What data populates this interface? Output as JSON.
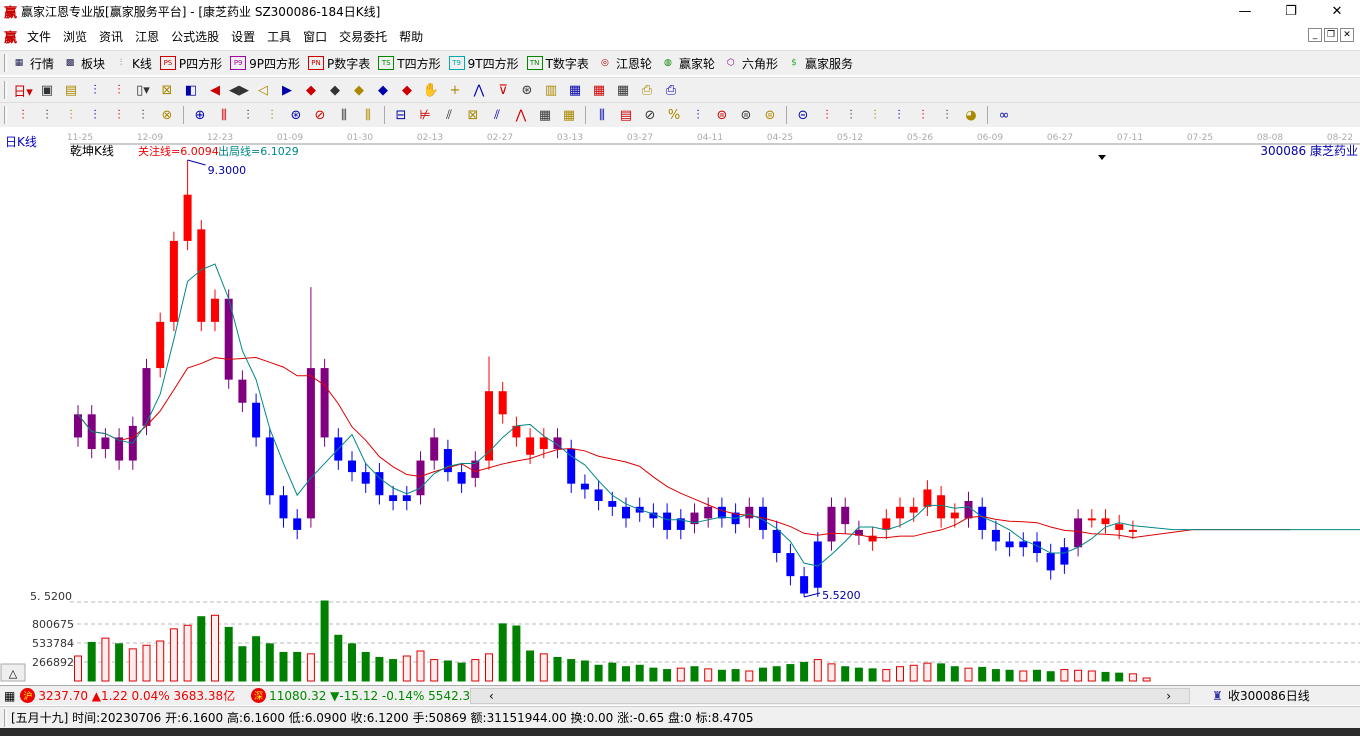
{
  "window": {
    "logo": "赢",
    "title": "赢家江恩专业版[赢家服务平台] - [康芝药业  SZ300086-184日K线]",
    "min": "—",
    "max": "❐",
    "close": "✕"
  },
  "menu": {
    "logo": "赢",
    "items": [
      "文件",
      "浏览",
      "资讯",
      "江恩",
      "公式选股",
      "设置",
      "工具",
      "窗口",
      "交易委托",
      "帮助"
    ]
  },
  "toolbar1": [
    {
      "icon": "grid-icon",
      "glyph": "▦",
      "label": "行情"
    },
    {
      "icon": "blocks-icon",
      "glyph": "▩",
      "label": "板块"
    },
    {
      "icon": "candles-icon",
      "glyph": "⫶",
      "label": "K线"
    },
    {
      "icon": "ps-icon",
      "glyph": "PS",
      "label": "P四方形",
      "color": "#c00"
    },
    {
      "icon": "p9-icon",
      "glyph": "P9",
      "label": "9P四方形",
      "color": "#a0a"
    },
    {
      "icon": "pn-icon",
      "glyph": "PN",
      "label": "P数字表",
      "color": "#c00"
    },
    {
      "icon": "ts-icon",
      "glyph": "TS",
      "label": "T四方形",
      "color": "#080"
    },
    {
      "icon": "t9-icon",
      "glyph": "T9",
      "label": "9T四方形",
      "color": "#0aa"
    },
    {
      "icon": "tn-icon",
      "glyph": "TN",
      "label": "T数字表",
      "color": "#080"
    },
    {
      "icon": "gann-wheel-icon",
      "glyph": "◎",
      "label": "江恩轮",
      "color": "#a00"
    },
    {
      "icon": "winner-wheel-icon",
      "glyph": "◍",
      "label": "赢家轮",
      "color": "#080"
    },
    {
      "icon": "hexagon-icon",
      "glyph": "⬡",
      "label": "六角形",
      "color": "#808"
    },
    {
      "icon": "dollar-icon",
      "glyph": "$",
      "label": "赢家服务",
      "color": "#3a3"
    }
  ],
  "toolbar2_glyphs": [
    "日▾",
    "▣",
    "▤",
    "⫶",
    "⫶",
    "▯▾",
    "⊠",
    "◧",
    "◀",
    "◀▶",
    "◁",
    "▶",
    "◆",
    "◆",
    "◆",
    "◆",
    "◆",
    "✋",
    "+",
    "⋀",
    "⊽",
    "⊛",
    "▥",
    "▦",
    "▦",
    "▦",
    "⎙",
    "⎙"
  ],
  "toolbar3_glyphs": [
    "⫶",
    "⫶",
    "⫶",
    "⫶",
    "⫶",
    "⫶",
    "⊗",
    "⊕",
    "⫼",
    "⫶",
    "⫶",
    "⊛",
    "⊘",
    "⫼",
    "⫼",
    "⊟",
    "⊭",
    "⫽",
    "⊠",
    "⫽",
    "⋀",
    "▦",
    "▦",
    "⫼",
    "▤",
    "⊘",
    "%",
    "⫶",
    "⊜",
    "⊜",
    "⊜",
    "⊝",
    "⫶",
    "⫶",
    "⫶",
    "⫶",
    "⫶",
    "⫶",
    "◕",
    "∞"
  ],
  "chart": {
    "period_label": "日K线",
    "indicator_name": "乾坤K线",
    "focus_line": "关注线=6.0094",
    "exit_line": "出局线=6.1029",
    "stock_label": "300086  康芝药业",
    "high_label": "9.3000",
    "low_label": "5.5200",
    "price_axis_label": "5. 5200",
    "volume_axis_labels": [
      "800675",
      "533784",
      "266892"
    ],
    "dates": [
      "11-25",
      "12-09",
      "12-23",
      "01-09",
      "01-30",
      "02-13",
      "02-27",
      "03-13",
      "03-27",
      "04-11",
      "04-25",
      "05-12",
      "05-26",
      "06-09",
      "06-27",
      "07-11",
      "07-25",
      "08-08",
      "08-22"
    ]
  },
  "chart_data": {
    "type": "candlestick",
    "price_range": [
      5.52,
      9.3
    ],
    "candles_oc_color": [
      [
        6.9,
        7.1,
        "p"
      ],
      [
        7.1,
        6.8,
        "p"
      ],
      [
        6.8,
        6.9,
        "p"
      ],
      [
        6.9,
        6.7,
        "p"
      ],
      [
        6.7,
        7.0,
        "p"
      ],
      [
        7.0,
        7.5,
        "p"
      ],
      [
        7.5,
        7.9,
        "r"
      ],
      [
        7.9,
        8.6,
        "r"
      ],
      [
        8.6,
        9.0,
        "r"
      ],
      [
        8.7,
        7.9,
        "r"
      ],
      [
        7.9,
        8.1,
        "r"
      ],
      [
        8.1,
        7.4,
        "p"
      ],
      [
        7.4,
        7.2,
        "p"
      ],
      [
        7.2,
        6.9,
        "b"
      ],
      [
        6.9,
        6.4,
        "b"
      ],
      [
        6.4,
        6.2,
        "b"
      ],
      [
        6.2,
        6.1,
        "b"
      ],
      [
        6.2,
        7.5,
        "p"
      ],
      [
        7.5,
        6.9,
        "p"
      ],
      [
        6.9,
        6.7,
        "b"
      ],
      [
        6.7,
        6.6,
        "b"
      ],
      [
        6.6,
        6.5,
        "b"
      ],
      [
        6.6,
        6.4,
        "b"
      ],
      [
        6.4,
        6.35,
        "b"
      ],
      [
        6.35,
        6.4,
        "b"
      ],
      [
        6.4,
        6.7,
        "p"
      ],
      [
        6.7,
        6.9,
        "p"
      ],
      [
        6.8,
        6.6,
        "b"
      ],
      [
        6.6,
        6.5,
        "b"
      ],
      [
        6.55,
        6.7,
        "p"
      ],
      [
        6.7,
        7.3,
        "r"
      ],
      [
        7.3,
        7.1,
        "r"
      ],
      [
        7.0,
        6.9,
        "r"
      ],
      [
        6.9,
        6.75,
        "r"
      ],
      [
        6.8,
        6.9,
        "r"
      ],
      [
        6.9,
        6.8,
        "p"
      ],
      [
        6.8,
        6.5,
        "b"
      ],
      [
        6.5,
        6.45,
        "b"
      ],
      [
        6.45,
        6.35,
        "b"
      ],
      [
        6.35,
        6.3,
        "b"
      ],
      [
        6.3,
        6.2,
        "b"
      ],
      [
        6.3,
        6.25,
        "b"
      ],
      [
        6.25,
        6.2,
        "b"
      ],
      [
        6.25,
        6.1,
        "b"
      ],
      [
        6.1,
        6.2,
        "b"
      ],
      [
        6.25,
        6.15,
        "p"
      ],
      [
        6.2,
        6.3,
        "p"
      ],
      [
        6.3,
        6.2,
        "b"
      ],
      [
        6.25,
        6.15,
        "b"
      ],
      [
        6.2,
        6.3,
        "p"
      ],
      [
        6.3,
        6.1,
        "b"
      ],
      [
        6.1,
        5.9,
        "b"
      ],
      [
        5.9,
        5.7,
        "b"
      ],
      [
        5.7,
        5.55,
        "b"
      ],
      [
        5.6,
        6.0,
        "b"
      ],
      [
        6.0,
        6.3,
        "p"
      ],
      [
        6.3,
        6.15,
        "p"
      ],
      [
        6.1,
        6.05,
        "p"
      ],
      [
        6.05,
        6.0,
        "r"
      ],
      [
        6.1,
        6.2,
        "r"
      ],
      [
        6.2,
        6.3,
        "r"
      ],
      [
        6.25,
        6.3,
        "r"
      ],
      [
        6.3,
        6.45,
        "r"
      ],
      [
        6.4,
        6.2,
        "r"
      ],
      [
        6.25,
        6.2,
        "r"
      ],
      [
        6.2,
        6.35,
        "p"
      ],
      [
        6.3,
        6.1,
        "b"
      ],
      [
        6.1,
        6.0,
        "b"
      ],
      [
        6.0,
        5.95,
        "b"
      ],
      [
        5.95,
        6.0,
        "b"
      ],
      [
        6.0,
        5.9,
        "b"
      ],
      [
        5.9,
        5.75,
        "b"
      ],
      [
        5.8,
        5.95,
        "b"
      ],
      [
        5.95,
        6.2,
        "p"
      ],
      [
        6.2,
        6.2,
        "r"
      ],
      [
        6.2,
        6.15,
        "r"
      ],
      [
        6.15,
        6.1,
        "r"
      ],
      [
        6.1,
        6.1,
        "r"
      ]
    ],
    "volumes": [
      350000,
      540000,
      600000,
      520000,
      450000,
      500000,
      560000,
      730000,
      780000,
      900000,
      920000,
      750000,
      480000,
      620000,
      520000,
      400000,
      400000,
      380000,
      1120000,
      640000,
      520000,
      400000,
      330000,
      300000,
      350000,
      420000,
      300000,
      280000,
      250000,
      300000,
      380000,
      800000,
      770000,
      420000,
      380000,
      330000,
      300000,
      280000,
      220000,
      250000,
      200000,
      220000,
      180000,
      160000,
      180000,
      200000,
      170000,
      150000,
      160000,
      140000,
      180000,
      200000,
      230000,
      260000,
      300000,
      240000,
      200000,
      180000,
      170000,
      160000,
      200000,
      220000,
      250000,
      240000,
      200000,
      180000,
      190000,
      160000,
      150000,
      140000,
      150000,
      130000,
      160000,
      150000,
      140000,
      120000,
      110000,
      100000
    ],
    "focus_line_value": 6.0094,
    "exit_line_value": 6.1029,
    "colors": {
      "up": "#ff0000",
      "down": "#0000ff",
      "neutral": "#800080",
      "ma_fast": "#008b8b",
      "ma_slow": "#d00000",
      "vol_down": "#008000"
    }
  },
  "bottom": {
    "sh_badge": "沪",
    "sh_text": "3237.70 ▲1.22 0.04% 3683.38亿",
    "sz_badge": "深",
    "sz_text": "11080.32 ▼-15.12 -0.14% 5542.38",
    "scroll_left": "‹",
    "scroll_right": "›",
    "right_label": "收300086日线"
  },
  "status": {
    "text": "[五月十九] 时间:20230706 开:6.1600 高:6.1600 低:6.0900 收:6.1200 手:50869 额:31151944.00 换:0.00 涨:-0.65 盘:0 标:8.4705"
  }
}
